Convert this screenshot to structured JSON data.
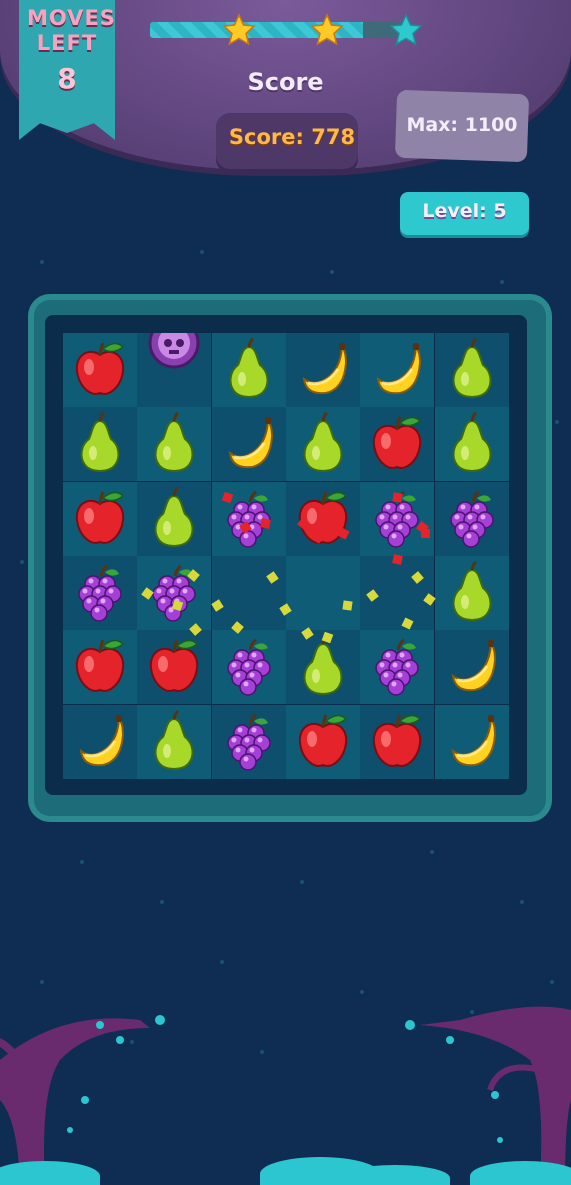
{
  "hud": {
    "moves_label": "MOVES LEFT",
    "moves_value": "8",
    "score_title": "Score",
    "score_text": "Score: 778",
    "max_text": "Max: 1100",
    "level_text": "Level: 5",
    "progress": 0.82,
    "stars_earned": 2,
    "stars_total": 3
  },
  "colors": {
    "background": "#0f2d52",
    "accent_teal": "#2ec8cf",
    "score_orange": "#ffb84a",
    "star_gold": "#ffc928",
    "star_empty": "#2ec8cf"
  },
  "board": {
    "rows": [
      [
        "apple",
        "skull",
        "pear",
        "banana",
        "banana",
        "pear"
      ],
      [
        "pear",
        "pear",
        "banana",
        "pear",
        "apple",
        "pear"
      ],
      [
        "apple",
        "pear",
        "grape",
        "apple",
        "grape",
        "grape"
      ],
      [
        "grape",
        "grape",
        "empty",
        "empty",
        "empty",
        "pear"
      ],
      [
        "apple",
        "apple",
        "grape",
        "pear",
        "grape",
        "banana"
      ],
      [
        "banana",
        "pear",
        "grape",
        "apple",
        "apple",
        "banana"
      ]
    ]
  }
}
